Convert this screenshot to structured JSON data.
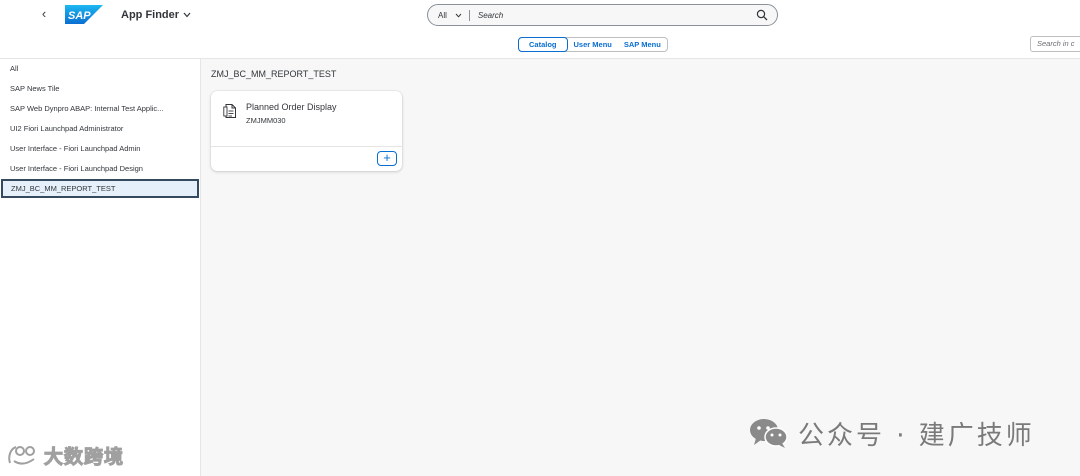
{
  "header": {
    "back_label": "‹",
    "logo_text": "SAP",
    "app_title": "App Finder",
    "search": {
      "scope": "All",
      "placeholder": "Search"
    }
  },
  "sub_header": {
    "tabs": [
      {
        "label": "Catalog",
        "active": true
      },
      {
        "label": "User Menu",
        "active": false
      },
      {
        "label": "SAP Menu",
        "active": false
      }
    ],
    "catalog_search_placeholder": "Search in c"
  },
  "catalogs": [
    {
      "label": "All"
    },
    {
      "label": "SAP News Tile"
    },
    {
      "label": "SAP Web Dynpro ABAP: Internal Test Applic..."
    },
    {
      "label": "UI2 Fiori Launchpad Administrator"
    },
    {
      "label": "User Interface - Fiori Launchpad Admin"
    },
    {
      "label": "User Interface - Fiori Launchpad Design"
    },
    {
      "label": "ZMJ_BC_MM_REPORT_TEST",
      "selected": true
    }
  ],
  "main": {
    "section_title": "ZMJ_BC_MM_REPORT_TEST",
    "tiles": [
      {
        "title": "Planned Order Display",
        "subtitle": "ZMJMM030",
        "add_label": "+"
      }
    ]
  },
  "watermarks": {
    "left": "大数跨境",
    "right": "公众号 · 建广技师"
  },
  "colors": {
    "accent": "#0a6ed1",
    "selected_bg": "#e5f0fa",
    "selected_border": "#354a5f",
    "content_bg": "#f7f7f7"
  }
}
